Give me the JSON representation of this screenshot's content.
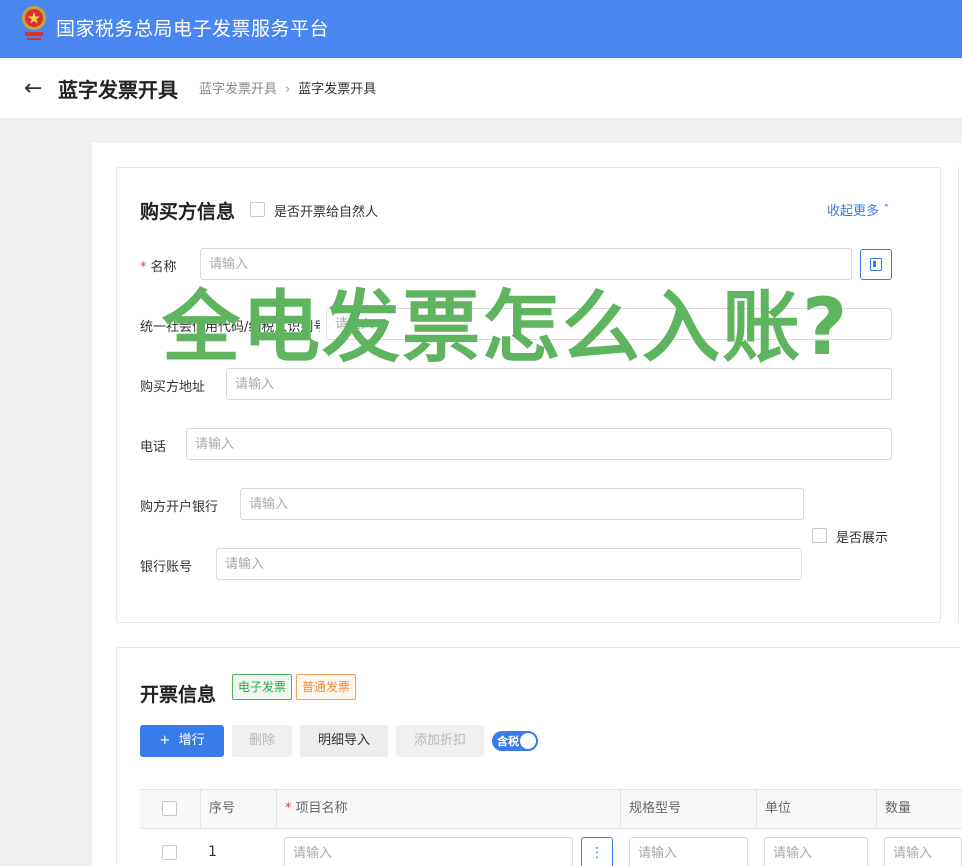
{
  "app": {
    "title": "国家税务总局电子发票服务平台",
    "logo_icon": "tax-emblem-icon"
  },
  "header": {
    "page_title": "蓝字发票开具",
    "breadcrumb": [
      "蓝字发票开具",
      "蓝字发票开具"
    ]
  },
  "buyer": {
    "section_title": "购买方信息",
    "natural_person_label": "是否开票给自然人",
    "collapse_label": "收起更多",
    "name_label": "名称",
    "tax_id_label": "统一社会信用代码/纳税人识别号",
    "address_label": "购买方地址",
    "phone_label": "电话",
    "bank_label": "购方开户银行",
    "account_label": "银行账号",
    "show_label": "是否展示",
    "placeholder": "请输入"
  },
  "overlay_text": "全电发票怎么入账?",
  "invoice": {
    "section_title": "开票信息",
    "tag_electronic": "电子发票",
    "tag_normal": "普通发票",
    "add_row_label": "增行",
    "delete_label": "删除",
    "import_label": "明细导入",
    "discount_label": "添加折扣",
    "tax_included_label": "含税",
    "columns": [
      "序号",
      "项目名称",
      "规格型号",
      "单位",
      "数量"
    ],
    "rows": [
      {
        "index": "1"
      }
    ],
    "placeholder": "请输入"
  },
  "colors": {
    "primary": "#3a7bea",
    "topbar": "#4a86f0",
    "overlay": "#5fb55f"
  }
}
